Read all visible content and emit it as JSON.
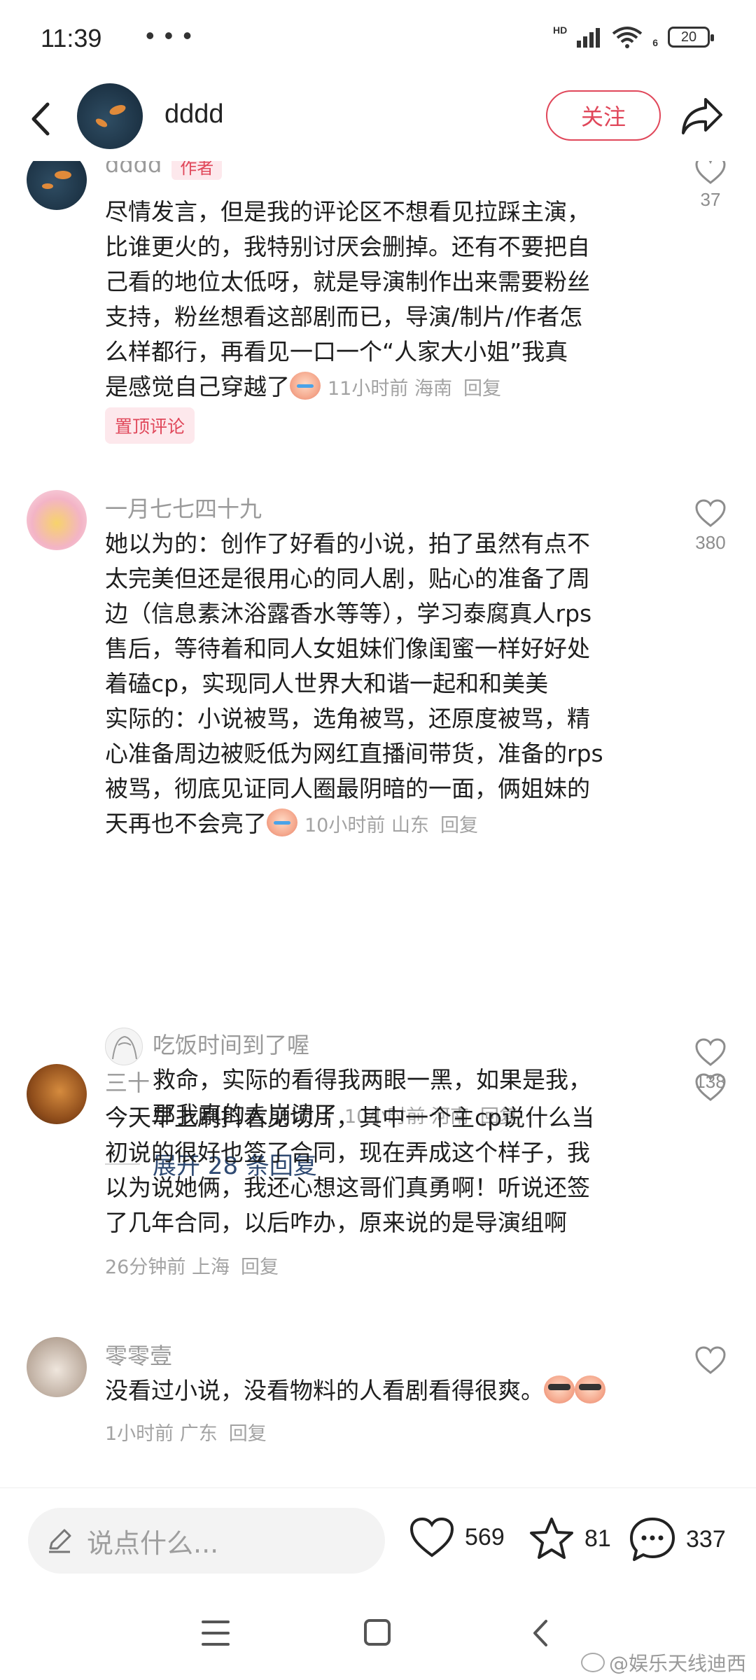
{
  "status_bar": {
    "time": "11:39",
    "dots": "• • •",
    "network": "HD",
    "network_sub": "6",
    "battery": "20"
  },
  "header": {
    "username": "dddd",
    "follow_label": "关注"
  },
  "comments": [
    {
      "username": "dddd",
      "tag": "作者",
      "lines": [
        "尽情发言，但是我的评论区不想看见拉踩主演，",
        "比谁更火的，我特别讨厌会删掉。还有不要把自",
        "己看的地位太低呀，就是导演制作出来需要粉丝",
        "支持，粉丝想看这部剧而已，导演/制片/作者怎",
        "么样都行，再看见一口一个“人家大小姐”我真",
        "是感觉自己穿越了"
      ],
      "time": "11小时前",
      "location": "海南",
      "reply": "回复",
      "pinned": "置顶评论",
      "likes": "37"
    },
    {
      "username": "一月七七四十九",
      "lines": [
        "她以为的：创作了好看的小说，拍了虽然有点不",
        "太完美但还是很用心的同人剧，贴心的准备了周",
        "边（信息素沐浴露香水等等），学习泰腐真人rps",
        "售后，等待着和同人女姐妹们像闺蜜一样好好处",
        "着磕cp，实现同人世界大和谐一起和和美美",
        "实际的：小说被骂，选角被骂，还原度被骂，精",
        "心准备周边被贬低为网红直播间带货，准备的rps",
        "被骂，彻底见证同人圈最阴暗的一面，俩姐妹的",
        "天再也不会亮了"
      ],
      "time": "10小时前",
      "location": "山东",
      "reply": "回复",
      "likes": "380",
      "sub_reply": {
        "username": "吃饭时间到了喔",
        "lines": [
          "救命，实际的看得我两眼一黑，如果是我，",
          "那我真的大崩溃了"
        ],
        "time": "10小时前",
        "location": "河南",
        "reply": "回复",
        "likes": "138"
      },
      "expand": "展开 28 条回复"
    },
    {
      "username": "三十",
      "lines": [
        "今天早上刷抖看见切片，其中一个主cp说什么当",
        "初说的很好也签了合同，现在弄成这个样子，我",
        "以为说她俩，我还心想这哥们真勇啊！听说还签",
        "了几年合同，以后咋办，原来说的是导演组啊"
      ],
      "time": "26分钟前",
      "location": "上海",
      "reply": "回复"
    },
    {
      "username": "零零壹",
      "lines": [
        "没看过小说，没看物料的人看剧看得很爽。"
      ],
      "time": "1小时前",
      "location": "广东",
      "reply": "回复"
    }
  ],
  "bottom_bar": {
    "input_placeholder": "说点什么...",
    "likes": "569",
    "favorites": "81",
    "comments": "337"
  },
  "watermark": "@娱乐天线迪西",
  "colors": {
    "accent": "#e0475a",
    "expand_link": "#2f4a72",
    "meta_gray": "#a3a3a3"
  }
}
